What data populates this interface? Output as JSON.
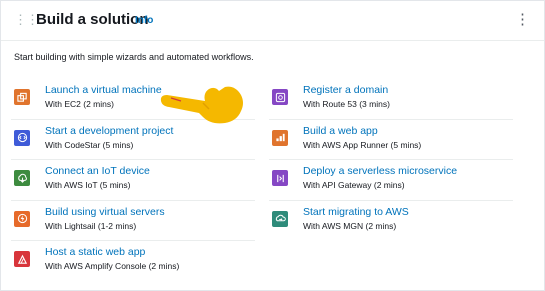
{
  "header": {
    "title": "Build a solution",
    "info_label": "Info"
  },
  "subtitle": "Start building with simple wizards and automated workflows.",
  "left_items": [
    {
      "title": "Launch a virtual machine",
      "subtitle": "With EC2 (2 mins)",
      "icon": "ec2-icon"
    },
    {
      "title": "Start a development project",
      "subtitle": "With CodeStar (5 mins)",
      "icon": "codestar-icon"
    },
    {
      "title": "Connect an IoT device",
      "subtitle": "With AWS IoT (5 mins)",
      "icon": "iot-icon"
    },
    {
      "title": "Build using virtual servers",
      "subtitle": "With Lightsail (1-2 mins)",
      "icon": "lightsail-icon"
    },
    {
      "title": "Host a static web app",
      "subtitle": "With AWS Amplify Console (2 mins)",
      "icon": "amplify-icon"
    }
  ],
  "right_items": [
    {
      "title": "Register a domain",
      "subtitle": "With Route 53 (3 mins)",
      "icon": "route53-icon"
    },
    {
      "title": "Build a web app",
      "subtitle": "With AWS App Runner (5 mins)",
      "icon": "app-runner-icon"
    },
    {
      "title": "Deploy a serverless microservice",
      "subtitle": "With API Gateway (2 mins)",
      "icon": "api-gateway-icon"
    },
    {
      "title": "Start migrating to AWS",
      "subtitle": "With AWS MGN (2 mins)",
      "icon": "mgn-icon"
    }
  ],
  "colors": {
    "link": "#0073bb",
    "compute": "#e0742d",
    "developer": "#3f5bd8",
    "iot": "#3d8b3f",
    "amplify": "#d8353b",
    "networking": "#8547c4",
    "migration": "#2e8b7a",
    "hand": "#f5b800"
  }
}
